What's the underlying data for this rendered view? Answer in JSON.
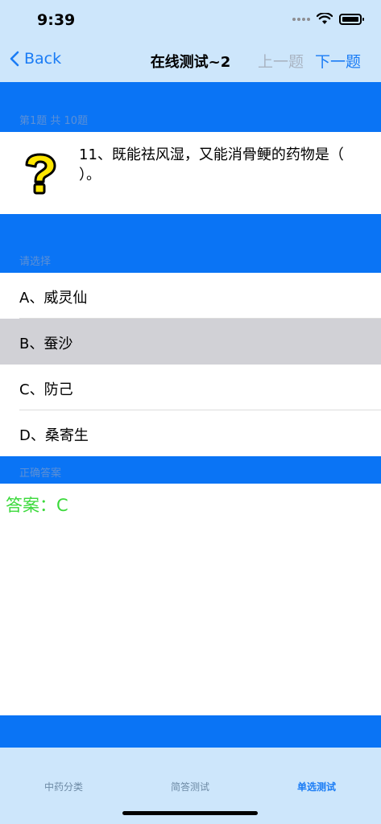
{
  "status_bar": {
    "time": "9:39"
  },
  "nav": {
    "back_label": "Back",
    "title": "在线测试~2",
    "prev_label": "上一题",
    "next_label": "下一题"
  },
  "question_section": {
    "header": "第1题 共 10题",
    "icon": "question-mark-icon",
    "text": "11、既能祛风湿，又能消骨鲠的药物是（          ）。"
  },
  "options_section": {
    "header": "请选择",
    "options": [
      {
        "label": "A、威灵仙",
        "selected": false
      },
      {
        "label": "B、蚕沙",
        "selected": true
      },
      {
        "label": "C、防己",
        "selected": false
      },
      {
        "label": "D、桑寄生",
        "selected": false
      }
    ]
  },
  "answer_section": {
    "header": "正确答案",
    "answer": "答案：C",
    "answer_color": "#3ad93a"
  },
  "tabs": [
    {
      "label": "中药分类",
      "active": false
    },
    {
      "label": "简答测试",
      "active": false
    },
    {
      "label": "单选测试",
      "active": true
    }
  ],
  "colors": {
    "accent": "#1a7cf5",
    "band": "#0a74f5",
    "bar_background": "#cde6fb",
    "selected_row": "#d1d1d6"
  }
}
